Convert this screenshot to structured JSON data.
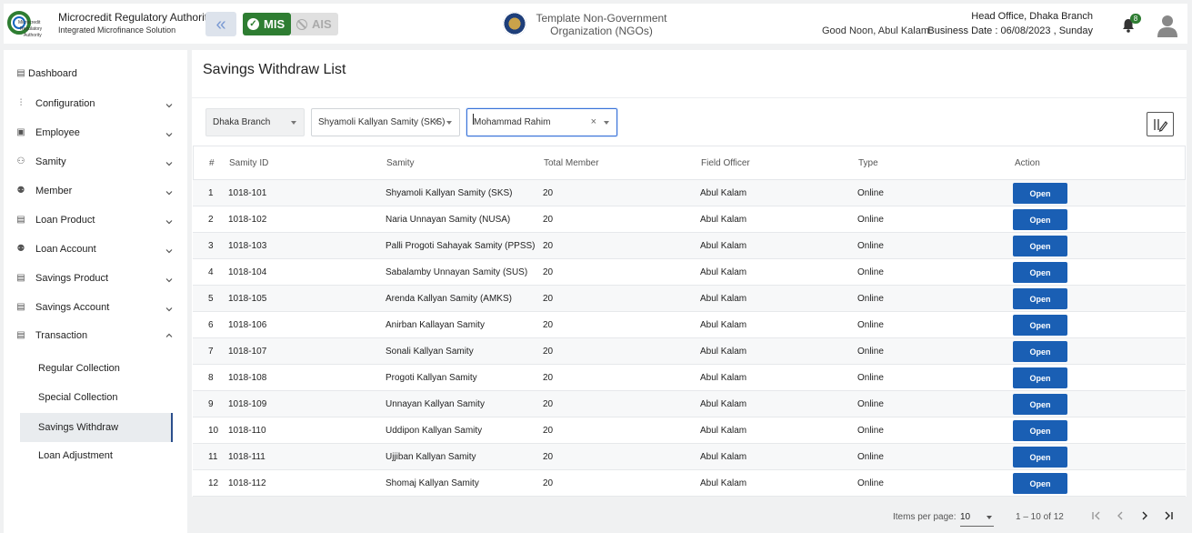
{
  "header": {
    "org_name": "Microcredit Regulatory Authority",
    "org_sub": "Integrated Microfinance Solution",
    "logo_text": "Microcredit Regulatory Authority",
    "mis_label": "MIS",
    "ais_label": "AIS",
    "ngo_title": "Template Non-Government Organization (NGOs)",
    "greeting": "Good Noon, Abul Kalam",
    "branch": "Head Office, Dhaka Branch",
    "business_date": "Business Date : 06/08/2023 , Sunday",
    "notification_count": "8",
    "accent_green": "#2e7d32",
    "primary_blue": "#1a5fb4"
  },
  "sidebar": {
    "items": [
      {
        "label": "Dashboard",
        "icon": "dashboard-icon"
      },
      {
        "label": "Configuration",
        "icon": "sliders-icon"
      },
      {
        "label": "Employee",
        "icon": "id-card-icon"
      },
      {
        "label": "Samity",
        "icon": "group-icon"
      },
      {
        "label": "Member",
        "icon": "members-icon"
      },
      {
        "label": "Loan Product",
        "icon": "doc-icon"
      },
      {
        "label": "Loan Account",
        "icon": "members-icon"
      },
      {
        "label": "Savings Product",
        "icon": "doc-icon"
      },
      {
        "label": "Savings Account",
        "icon": "doc-icon"
      },
      {
        "label": "Transaction",
        "icon": "doc-icon"
      }
    ],
    "sub_items": [
      {
        "label": "Regular Collection"
      },
      {
        "label": "Special Collection"
      },
      {
        "label": "Savings Withdraw",
        "active": true
      },
      {
        "label": "Loan Adjustment"
      }
    ]
  },
  "main": {
    "title": "Savings Withdraw List",
    "filters": {
      "branch": "Dhaka Branch",
      "samity": "Shyamoli Kallyan Samity (SKS)",
      "member": "Mohammad Rahim"
    },
    "columns": [
      "#",
      "Samity ID",
      "Samity",
      "Total Member",
      "Field Officer",
      "Type",
      "Action"
    ],
    "rows": [
      {
        "num": "1",
        "id": "1018-101",
        "samity": "Shyamoli Kallyan Samity (SKS)",
        "total": "20",
        "officer": "Abul Kalam",
        "type": "Online",
        "action": "Open"
      },
      {
        "num": "2",
        "id": "1018-102",
        "samity": "Naria Unnayan Samity (NUSA)",
        "total": "20",
        "officer": "Abul Kalam",
        "type": "Online",
        "action": "Open"
      },
      {
        "num": "3",
        "id": "1018-103",
        "samity": "Palli Progoti Sahayak Samity (PPSS)",
        "total": "20",
        "officer": "Abul Kalam",
        "type": "Online",
        "action": "Open"
      },
      {
        "num": "4",
        "id": "1018-104",
        "samity": "Sabalamby Unnayan Samity (SUS)",
        "total": "20",
        "officer": "Abul Kalam",
        "type": "Online",
        "action": "Open"
      },
      {
        "num": "5",
        "id": "1018-105",
        "samity": "Arenda Kallyan Samity (AMKS)",
        "total": "20",
        "officer": "Abul Kalam",
        "type": "Online",
        "action": "Open"
      },
      {
        "num": "6",
        "id": "1018-106",
        "samity": "Anirban Kallayan Samity",
        "total": "20",
        "officer": "Abul Kalam",
        "type": "Online",
        "action": "Open"
      },
      {
        "num": "7",
        "id": "1018-107",
        "samity": "Sonali Kallyan Samity",
        "total": "20",
        "officer": "Abul Kalam",
        "type": "Online",
        "action": "Open"
      },
      {
        "num": "8",
        "id": "1018-108",
        "samity": "Progoti Kallyan Samity",
        "total": "20",
        "officer": "Abul Kalam",
        "type": "Online",
        "action": "Open"
      },
      {
        "num": "9",
        "id": "1018-109",
        "samity": "Unnayan Kallyan Samity",
        "total": "20",
        "officer": "Abul Kalam",
        "type": "Online",
        "action": "Open"
      },
      {
        "num": "10",
        "id": "1018-110",
        "samity": "Uddipon Kallyan Samity",
        "total": "20",
        "officer": "Abul Kalam",
        "type": "Online",
        "action": "Open"
      },
      {
        "num": "11",
        "id": "1018-111",
        "samity": "Ujjiban Kallyan Samity",
        "total": "20",
        "officer": "Abul Kalam",
        "type": "Online",
        "action": "Open"
      },
      {
        "num": "12",
        "id": "1018-112",
        "samity": "Shomaj Kallyan Samity",
        "total": "20",
        "officer": "Abul Kalam",
        "type": "Online",
        "action": "Open"
      }
    ]
  },
  "paginator": {
    "items_per_page_label": "Items per page:",
    "items_per_page": "10",
    "range": "1 – 10 of 12"
  }
}
